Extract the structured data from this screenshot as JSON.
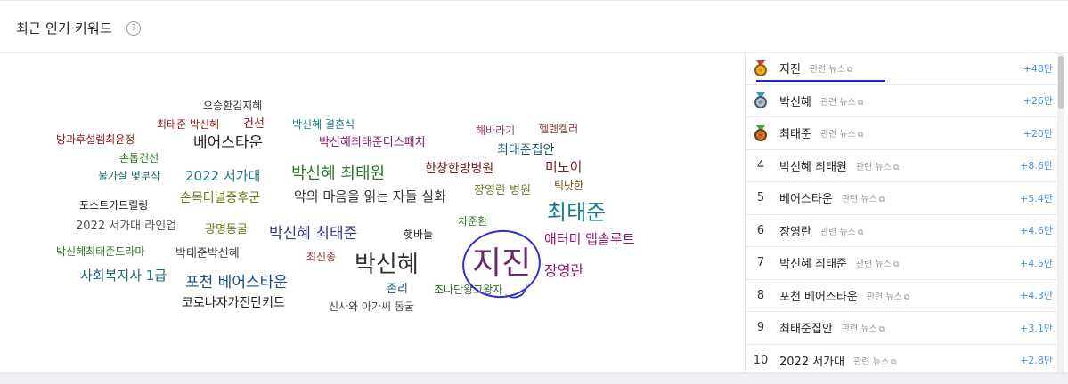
{
  "header": {
    "title": "최근 인기 키워드",
    "help_icon": "?"
  },
  "cloud": {
    "words": [
      {
        "id": "w1",
        "text": "오승환김지혜"
      },
      {
        "id": "w2",
        "text": "최태준 박신혜"
      },
      {
        "id": "w3",
        "text": "건선"
      },
      {
        "id": "w4",
        "text": "박신혜 결혼식"
      },
      {
        "id": "w5",
        "text": "해바라기"
      },
      {
        "id": "w6",
        "text": "헬렌켈러"
      },
      {
        "id": "w7",
        "text": "방과후설렘최윤정"
      },
      {
        "id": "w8",
        "text": "베어스타운"
      },
      {
        "id": "w9",
        "text": "박신혜최태준디스패치"
      },
      {
        "id": "w10",
        "text": "최태준집안"
      },
      {
        "id": "w11",
        "text": "손톱건선"
      },
      {
        "id": "w12",
        "text": "불가살 몇부작"
      },
      {
        "id": "w13",
        "text": "2022 서가대"
      },
      {
        "id": "w14",
        "text": "박신혜 최태원"
      },
      {
        "id": "w15",
        "text": "한창한방병원"
      },
      {
        "id": "w16",
        "text": "미노이"
      },
      {
        "id": "w17",
        "text": "틱낫한"
      },
      {
        "id": "w18",
        "text": "포스트카드킬링"
      },
      {
        "id": "w19",
        "text": "손목터널증후군"
      },
      {
        "id": "w20",
        "text": "악의 마음을 읽는 자들 실화"
      },
      {
        "id": "w21",
        "text": "장영란 병원"
      },
      {
        "id": "w22",
        "text": "최태준"
      },
      {
        "id": "w23",
        "text": "2022 서가대 라인업"
      },
      {
        "id": "w24",
        "text": "광명동굴"
      },
      {
        "id": "w25",
        "text": "박신혜 최태준"
      },
      {
        "id": "w26",
        "text": "햇바늘"
      },
      {
        "id": "w27",
        "text": "차준환"
      },
      {
        "id": "w28",
        "text": "애터미 앱솔루트"
      },
      {
        "id": "w29",
        "text": "박신혜최태준드라마"
      },
      {
        "id": "w30",
        "text": "박태준박신혜"
      },
      {
        "id": "w31",
        "text": "최신종"
      },
      {
        "id": "w32",
        "text": "박신혜"
      },
      {
        "id": "w33",
        "text": "지진"
      },
      {
        "id": "w34",
        "text": "장영란"
      },
      {
        "id": "w35",
        "text": "사회복지사 1급"
      },
      {
        "id": "w36",
        "text": "포천 베어스타운"
      },
      {
        "id": "w37",
        "text": "존리"
      },
      {
        "id": "w38",
        "text": "조나단왕고왕자"
      },
      {
        "id": "w39",
        "text": "코로나자가진단키트"
      },
      {
        "id": "w40",
        "text": "신사와 아가씨 동굴"
      }
    ]
  },
  "ranking": {
    "related_label": "관련 뉴스",
    "items": [
      {
        "rank": "1",
        "keyword": "지진",
        "delta": "+48만",
        "medal": "gold-medal-icon"
      },
      {
        "rank": "2",
        "keyword": "박신혜",
        "delta": "+26만",
        "medal": "silver-medal-icon"
      },
      {
        "rank": "3",
        "keyword": "최태준",
        "delta": "+20만",
        "medal": "bronze-medal-icon"
      },
      {
        "rank": "4",
        "keyword": "박신혜 최태원",
        "delta": "+8.6만"
      },
      {
        "rank": "5",
        "keyword": "베어스타운",
        "delta": "+5.4만"
      },
      {
        "rank": "6",
        "keyword": "장영란",
        "delta": "+4.6만"
      },
      {
        "rank": "7",
        "keyword": "박신혜 최태준",
        "delta": "+4.5만"
      },
      {
        "rank": "8",
        "keyword": "포천 베어스타운",
        "delta": "+4.3만"
      },
      {
        "rank": "9",
        "keyword": "최태준집안",
        "delta": "+3.1만"
      },
      {
        "rank": "10",
        "keyword": "2022 서가대",
        "delta": "+2.8만"
      }
    ]
  }
}
